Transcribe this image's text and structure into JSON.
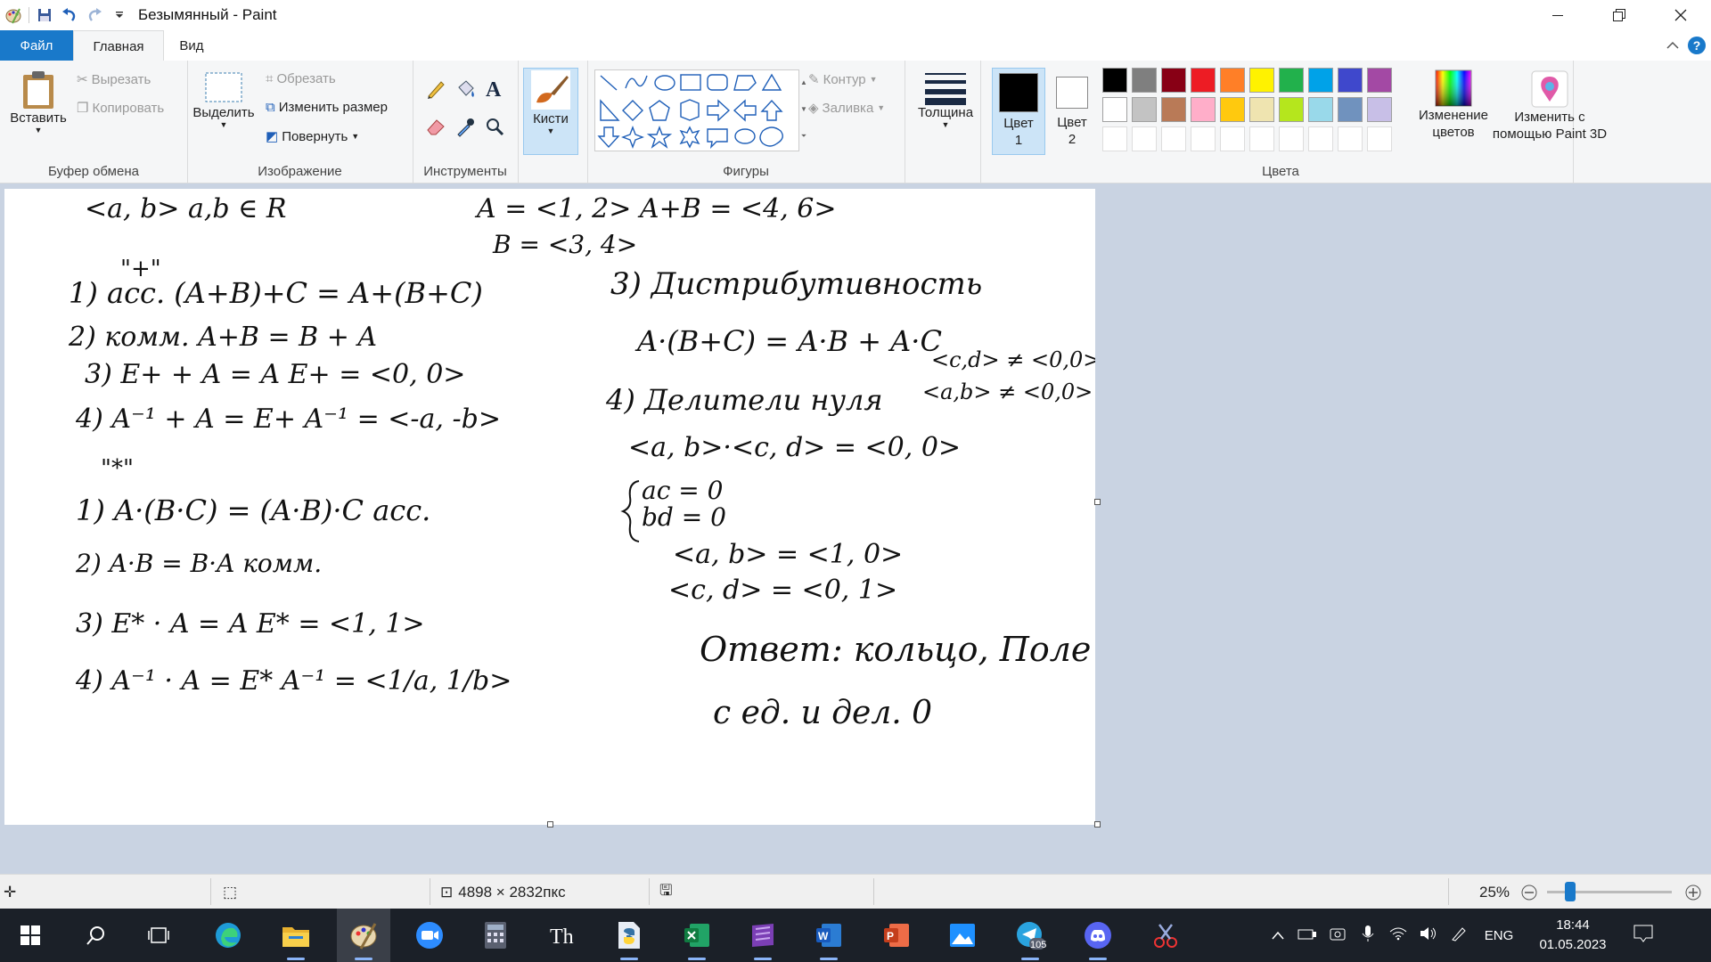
{
  "window": {
    "title": "Безымянный - Paint",
    "controls": [
      "minimize",
      "restore",
      "close"
    ]
  },
  "tabs": [
    {
      "label": "Файл"
    },
    {
      "label": "Главная"
    },
    {
      "label": "Вид"
    }
  ],
  "ribbon": {
    "clipboard": {
      "label": "Буфер обмена",
      "paste": "Вставить",
      "cut": "Вырезать",
      "copy": "Копировать"
    },
    "image": {
      "label": "Изображение",
      "select": "Выделить",
      "crop": "Обрезать",
      "resize": "Изменить размер",
      "rotate": "Повернуть"
    },
    "tools": {
      "label": "Инструменты"
    },
    "brushes": {
      "label": "Кисти"
    },
    "shapes": {
      "label": "Фигуры",
      "outline": "Контур",
      "fill": "Заливка"
    },
    "size": {
      "label": "Толщина"
    },
    "color1": {
      "label": "Цвет 1",
      "value": "#000000"
    },
    "color2": {
      "label": "Цвет 2",
      "value": "#ffffff"
    },
    "colors": {
      "label": "Цвета",
      "edit": "Изменение цветов",
      "row1": [
        "#000000",
        "#7f7f7f",
        "#880015",
        "#ed1c24",
        "#ff7f27",
        "#fff200",
        "#22b14c",
        "#00a2e8",
        "#3f48cc",
        "#a349a4"
      ],
      "row2": [
        "#ffffff",
        "#c3c3c3",
        "#b97a57",
        "#ffaec9",
        "#ffc90e",
        "#efe4b0",
        "#b5e61d",
        "#99d9ea",
        "#7092be",
        "#c8bfe7"
      ]
    },
    "paint3d": {
      "label": "Изменить с помощью Paint 3D"
    }
  },
  "canvas": {
    "handwriting": [
      "<a, b>   a,b ∈ R",
      "A = <1, 2>   A+B = <4, 6>",
      "B = <3, 4>",
      "\"+\"",
      "1) acc.  (A+B)+C = A+(B+C)",
      "2) комм.  A+B = B + A",
      "3) E+ + A = A      E+ = <0, 0>",
      "4) A⁻¹ + A = E+      A⁻¹ = <-a, -b>",
      "\"*\"",
      "1) A·(B·C) = (A·B)·C      acc.",
      "2) A·B = B·A   комм.",
      "3) E* · A = A      E* = <1, 1>",
      "4) A⁻¹ · A = E*      A⁻¹ = <1/a, 1/b>",
      "3) Дистрибутивность",
      "A·(B+C) = A·B + A·C",
      "<c,d> ≠ <0,0>",
      "<a,b> ≠ <0,0>",
      "4) Делители нуля",
      "<a, b>·<c, d> = <0, 0>",
      "ac = 0",
      "bd = 0",
      "<a, b> = <1, 0>",
      "<c, d> = <0, 1>",
      "Ответ: кольцо, Поле",
      "с ед. и дел. 0"
    ]
  },
  "status": {
    "image_size": "4898 × 2832пкс",
    "zoom": "25%"
  },
  "taskbar": {
    "telegram_badge": "105",
    "language": "ENG",
    "time": "18:44",
    "date": "01.05.2023"
  }
}
